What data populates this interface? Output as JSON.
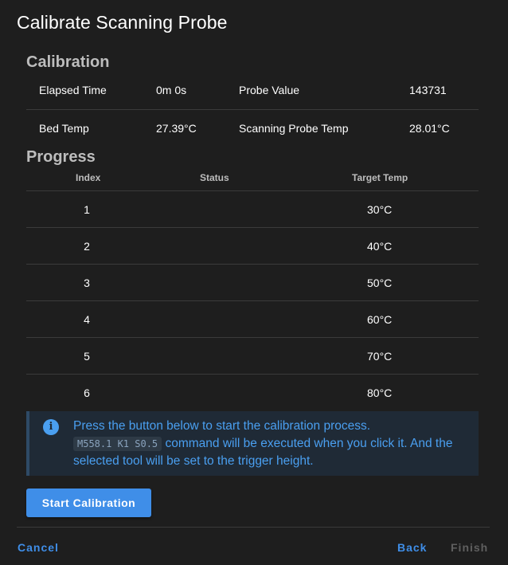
{
  "dialog": {
    "title": "Calibrate Scanning Probe"
  },
  "calibration": {
    "heading": "Calibration",
    "elapsed_label": "Elapsed Time",
    "elapsed_value": "0m 0s",
    "probe_label": "Probe Value",
    "probe_value": "143731",
    "bed_label": "Bed Temp",
    "bed_value": "27.39°C",
    "scan_label": "Scanning Probe Temp",
    "scan_value": "28.01°C"
  },
  "progress": {
    "heading": "Progress",
    "columns": [
      "Index",
      "Status",
      "Target Temp"
    ],
    "rows": [
      {
        "index": "1",
        "status": "",
        "temp": "30°C"
      },
      {
        "index": "2",
        "status": "",
        "temp": "40°C"
      },
      {
        "index": "3",
        "status": "",
        "temp": "50°C"
      },
      {
        "index": "4",
        "status": "",
        "temp": "60°C"
      },
      {
        "index": "5",
        "status": "",
        "temp": "70°C"
      },
      {
        "index": "6",
        "status": "",
        "temp": "80°C"
      }
    ]
  },
  "info": {
    "line1": "Press the button below to start the calibration process.",
    "code": "M558.1 K1 S0.5",
    "line2": " command will be executed when you click it. And the selected tool will be set to the trigger height."
  },
  "actions": {
    "start": "Start Calibration",
    "cancel": "Cancel",
    "back": "Back",
    "finish": "Finish"
  },
  "colors": {
    "background": "#1e1e1e",
    "accent": "#3f8ee8",
    "info_text": "#4a9ff0",
    "disabled": "#5f5f5f"
  }
}
